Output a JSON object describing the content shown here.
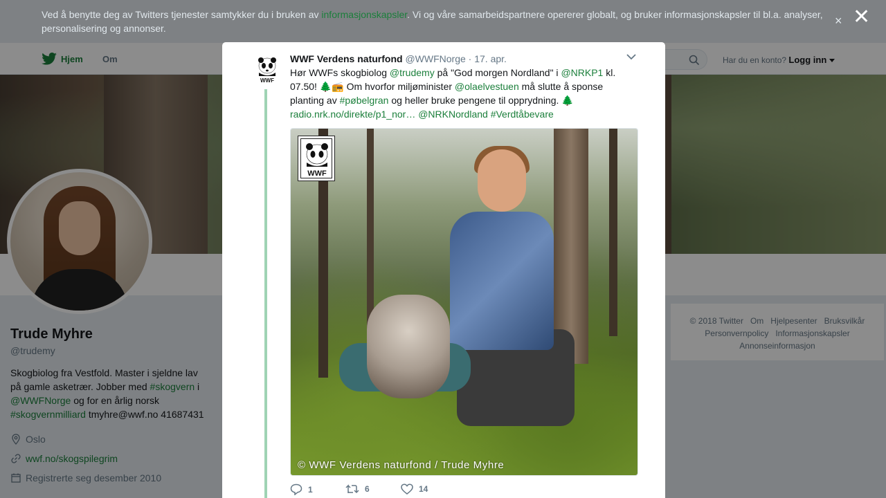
{
  "cookie_bar": {
    "text_before": "Ved å benytte deg av Twitters tjenester samtykker du i bruken av ",
    "link": "informasjonskapsler",
    "text_after": ". Vi og våre samarbeidspartnere opererer globalt, og bruker informasjonskapsler til bl.a. analyser, personalisering og annonser.",
    "close": "×"
  },
  "modal_close": "✕",
  "nav": {
    "home": "Hjem",
    "about": "Om",
    "account_prompt": "Har du en konto?",
    "login": "Logg inn"
  },
  "profile": {
    "name": "Trude Myhre",
    "handle": "@trudemy",
    "bio_parts": [
      "Skogbiolog fra Vestfold. Master i sjeldne lav på gamle asketrær. Jobber med ",
      "#skogvern",
      " i ",
      "@WWFNorge",
      " og for en årlig norsk ",
      "#skogvernmilliard",
      " tmyhre@wwf.no 41687431"
    ],
    "location": "Oslo",
    "website": "wwf.no/skogspilegrim",
    "joined": "Registrerte seg desember 2010"
  },
  "footer": {
    "links": [
      "© 2018 Twitter",
      "Om",
      "Hjelpesenter",
      "Bruksvilkår",
      "Personvernpolicy",
      "Informasjonskapsler",
      "Annonseinformasjon"
    ]
  },
  "tweet": {
    "author": "WWF Verdens naturfond",
    "handle": "@WWFNorge",
    "separator": "·",
    "date": "17. apr.",
    "logo_text": "WWF",
    "body": [
      {
        "t": "Hør WWFs skogbiolog "
      },
      {
        "t": "@trudemy",
        "link": true
      },
      {
        "t": " på \"God morgen Nordland\" i "
      },
      {
        "t": "@NRKP1",
        "link": true
      },
      {
        "t": " kl. 07.50! 🌲📻 Om hvorfor miljøminister "
      },
      {
        "t": "@olaelvestuen",
        "link": true
      },
      {
        "t": " må slutte å sponse planting av "
      },
      {
        "t": "#pøbelgran",
        "link": true
      },
      {
        "t": " og heller bruke pengene til opprydning. 🌲 "
      },
      {
        "t": "radio.nrk.no/direkte/p1_nor…",
        "link": true
      },
      {
        "t": " "
      },
      {
        "t": "@NRKNordland",
        "link": true
      },
      {
        "t": " "
      },
      {
        "t": "#Verdtåbevare",
        "link": true
      }
    ],
    "image_caption": "© WWF Verdens naturfond / Trude Myhre",
    "image_logo_text": "WWF",
    "replies": "1",
    "retweets": "6",
    "likes": "14"
  },
  "colors": {
    "link": "#1b7f3b",
    "thread": "#9fd3b4"
  }
}
